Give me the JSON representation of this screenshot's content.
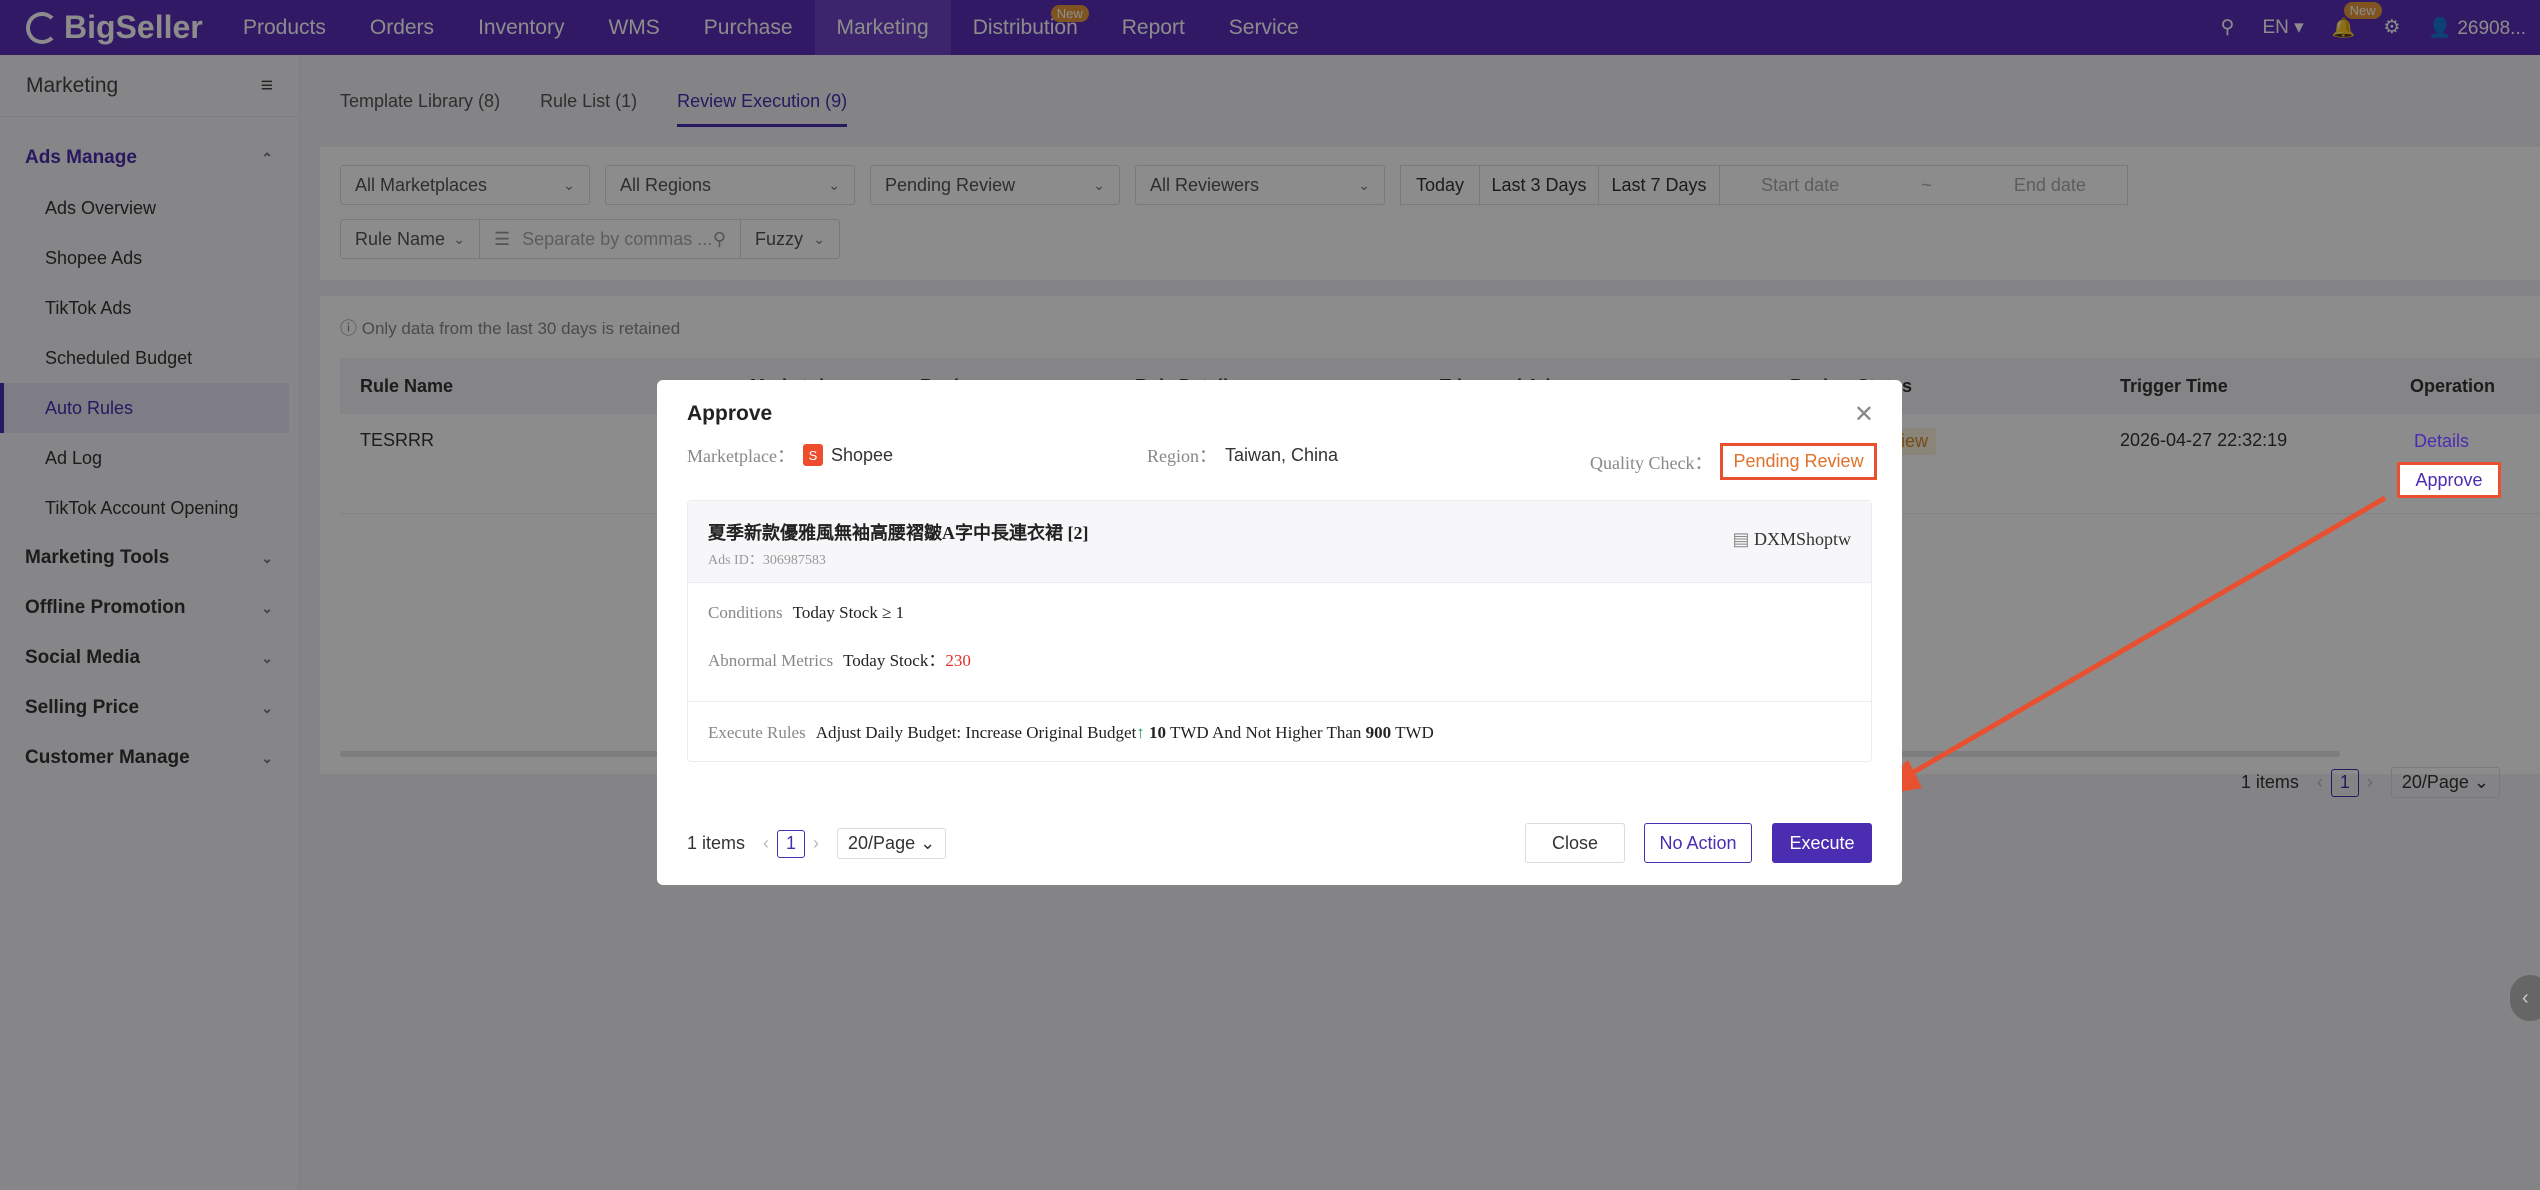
{
  "brand": "BigSeller",
  "nav": {
    "items": [
      "Products",
      "Orders",
      "Inventory",
      "WMS",
      "Purchase",
      "Marketing",
      "Distribution",
      "Report",
      "Service"
    ],
    "active": "Marketing",
    "distribution_badge": "New",
    "lang": "EN",
    "bell_badge": "New",
    "user": "26908..."
  },
  "sidebar": {
    "title": "Marketing",
    "groups": [
      {
        "label": "Ads Manage",
        "items": [
          "Ads Overview",
          "Shopee Ads",
          "TikTok Ads",
          "Scheduled Budget",
          "Auto Rules",
          "Ad Log",
          "TikTok Account Opening"
        ]
      },
      {
        "label": "Marketing Tools"
      },
      {
        "label": "Offline Promotion"
      },
      {
        "label": "Social Media"
      },
      {
        "label": "Selling Price"
      },
      {
        "label": "Customer Manage"
      }
    ]
  },
  "tabs": [
    "Template Library (8)",
    "Rule List (1)",
    "Review Execution (9)"
  ],
  "filters": {
    "marketplaces": "All Marketplaces",
    "regions": "All Regions",
    "status": "Pending Review",
    "reviewers": "All Reviewers",
    "today": "Today",
    "last3": "Last 3 Days",
    "last7": "Last 7 Days",
    "start_ph": "Start date",
    "range_sep": "~",
    "end_ph": "End date",
    "rule_name": "Rule Name",
    "search_ph": "Separate by commas ...",
    "fuzzy": "Fuzzy"
  },
  "table": {
    "note": "Only data from the last 30 days is retained",
    "headers": [
      "Rule Name",
      "Marketplace",
      "Region",
      "Rule Details",
      "Triggered Ads",
      "Review Status",
      "Trigger Time",
      "Operation"
    ],
    "row": {
      "rule_name": "TESRRR",
      "status_fragment": "iew",
      "trigger_time": "2026-04-27 22:32:19",
      "details": "Details",
      "approve": "Approve"
    },
    "pager": {
      "total": "1 items",
      "page": "1",
      "size": "20/Page"
    }
  },
  "modal": {
    "title": "Approve",
    "marketplace_label": "Marketplace：",
    "marketplace": "Shopee",
    "region_label": "Region：",
    "region": "Taiwan, China",
    "qc_label": "Quality Check：",
    "qc_value": "Pending Review",
    "product_title": "夏季新款優雅風無袖高腰褶皺A字中長連衣裙 [2]",
    "ads_id": "Ads ID：306987583",
    "store": "DXMShoptw",
    "conditions_label": "Conditions",
    "conditions": "Today Stock ≥ 1",
    "abnormal_label": "Abnormal Metrics",
    "abnormal_prefix": "Today Stock：",
    "abnormal_value": "230",
    "execute_label": "Execute Rules",
    "execute_text": "Adjust Daily Budget: Increase Original Budget",
    "execute_amount": "10",
    "execute_mid": "TWD And Not Higher Than",
    "execute_max": "900",
    "execute_unit": "TWD",
    "pager_total": "1 items",
    "pager_page": "1",
    "pager_size": "20/Page",
    "btn_close": "Close",
    "btn_no_action": "No Action",
    "btn_execute": "Execute"
  },
  "colors": {
    "brand": "#5b2fb8",
    "accent": "#4a2db0",
    "annotation": "#e8502f"
  }
}
